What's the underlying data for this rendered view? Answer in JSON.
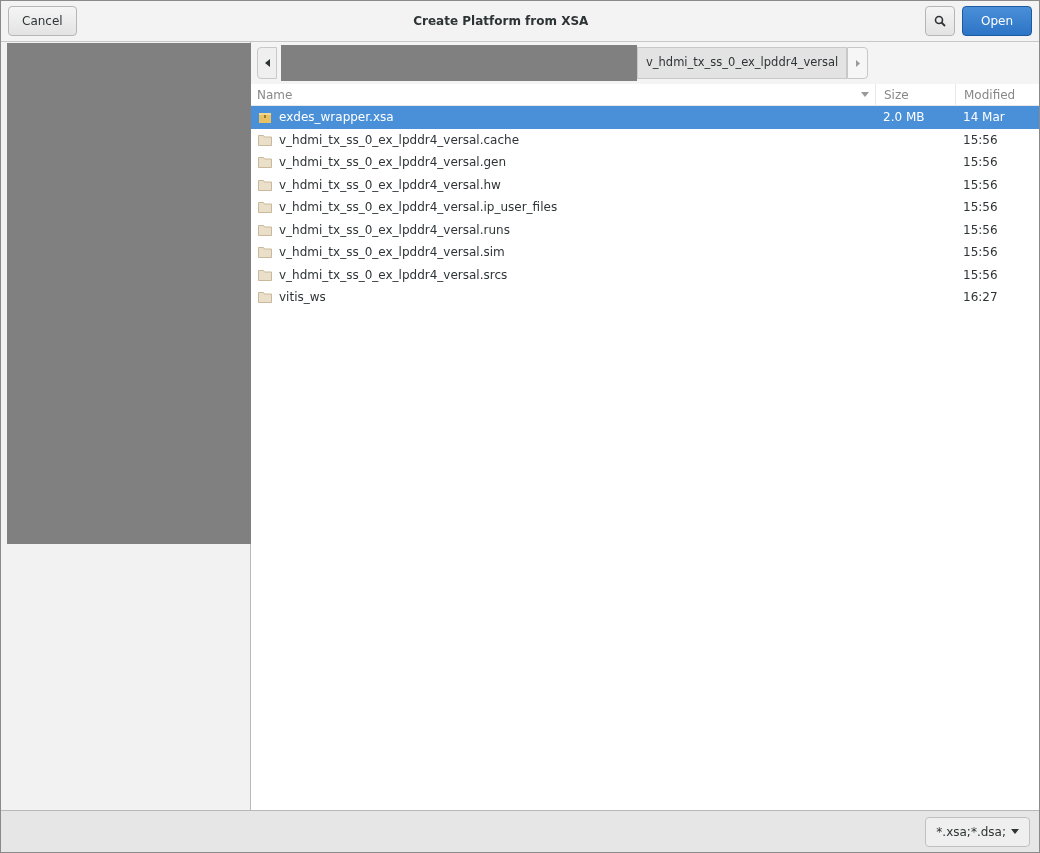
{
  "window": {
    "title": "Create Platform from XSA"
  },
  "header": {
    "cancel": "Cancel",
    "open": "Open"
  },
  "path_bar": {
    "crumbs": [
      {
        "label": "v_hdmi_tx_ss_0_ex_lpddr4_versal",
        "selected": true
      }
    ]
  },
  "table": {
    "columns": [
      {
        "label": "Name",
        "sorted": true
      },
      {
        "label": "Size",
        "sorted": false
      },
      {
        "label": "Modified",
        "sorted": false
      }
    ],
    "rows": [
      {
        "kind": "file",
        "name": "exdes_wrapper.xsa",
        "size": "2.0 MB",
        "modified": "14 Mar",
        "selected": true
      },
      {
        "kind": "folder",
        "name": "v_hdmi_tx_ss_0_ex_lpddr4_versal.cache",
        "modified": "15:56",
        "selected": false
      },
      {
        "kind": "folder",
        "name": "v_hdmi_tx_ss_0_ex_lpddr4_versal.gen",
        "modified": "15:56",
        "selected": false
      },
      {
        "kind": "folder",
        "name": "v_hdmi_tx_ss_0_ex_lpddr4_versal.hw",
        "modified": "15:56",
        "selected": false
      },
      {
        "kind": "folder",
        "name": "v_hdmi_tx_ss_0_ex_lpddr4_versal.ip_user_files",
        "modified": "15:56",
        "selected": false
      },
      {
        "kind": "folder",
        "name": "v_hdmi_tx_ss_0_ex_lpddr4_versal.runs",
        "modified": "15:56",
        "selected": false
      },
      {
        "kind": "folder",
        "name": "v_hdmi_tx_ss_0_ex_lpddr4_versal.sim",
        "modified": "15:56",
        "selected": false
      },
      {
        "kind": "folder",
        "name": "v_hdmi_tx_ss_0_ex_lpddr4_versal.srcs",
        "modified": "15:56",
        "selected": false
      },
      {
        "kind": "folder",
        "name": "vitis_ws",
        "modified": "16:27",
        "selected": false
      }
    ]
  },
  "filter": {
    "label": "*.xsa;*.dsa;"
  }
}
